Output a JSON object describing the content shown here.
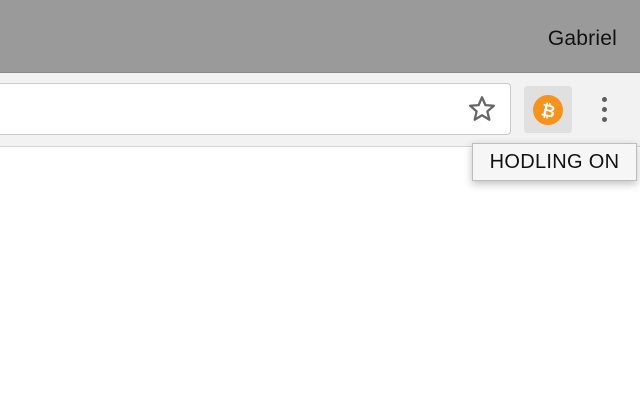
{
  "window": {
    "profile_name": "Gabriel"
  },
  "toolbar": {
    "address_value": "",
    "bookmark_icon": "star-outline-icon",
    "extension": {
      "icon": "bitcoin-icon",
      "icon_glyph": "₿",
      "color": "#f7931a",
      "tooltip": "HODLING ON"
    },
    "menu_icon": "vertical-ellipsis-icon"
  },
  "colors": {
    "titlebar": "#9a9a9a",
    "toolbar": "#f2f2f2",
    "extension_highlight": "#e0e0e0"
  }
}
